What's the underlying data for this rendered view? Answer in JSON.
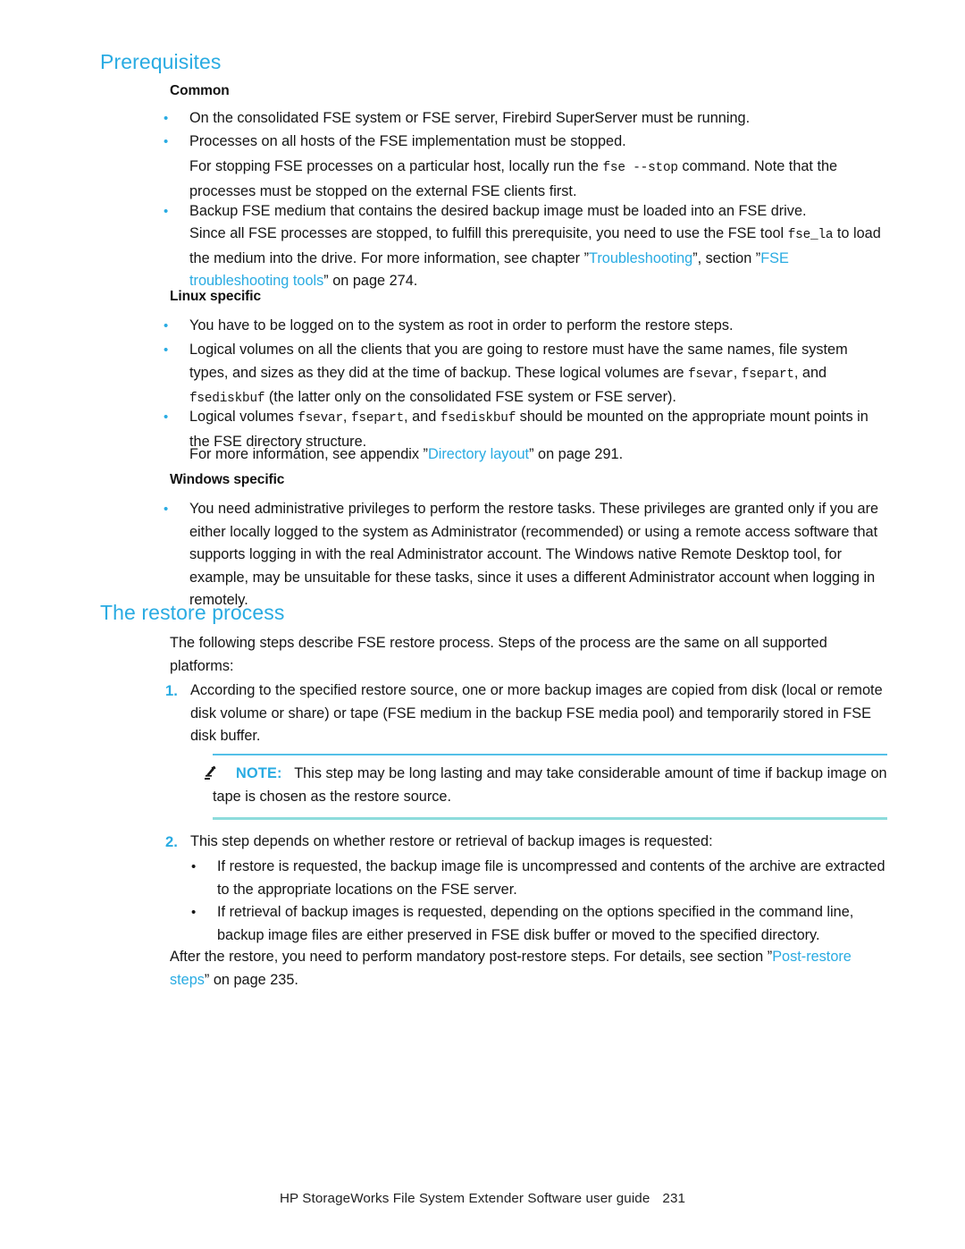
{
  "headings": {
    "prerequisites": "Prerequisites",
    "restore_process": "The restore process",
    "common": "Common",
    "linux_specific": "Linux specific",
    "windows_specific": "Windows specific"
  },
  "common": {
    "bullet_1": "On the consolidated FSE system or FSE server, Firebird SuperServer must be running.",
    "bullet_2": "Processes on all hosts of the FSE implementation must be stopped.",
    "para_2a": "For stopping FSE processes on a particular host, locally run the",
    "para_2a_cmd": "fse --stop",
    "para_2b": "command. Note that the processes must be stopped on the external FSE clients first.",
    "bullet_3": "Backup FSE medium that contains the desired backup image must be loaded into an FSE drive.",
    "para_3a": "Since all FSE processes are stopped, to fulfill this prerequisite, you need to use the FSE tool",
    "para_3a_cmd": "fse_la",
    "para_3b": "to load the medium into the drive. For more information, see chapter ”",
    "para_3_link1": "Troubleshooting",
    "para_3c": "”, section ”",
    "para_3_link2": "FSE troubleshooting tools",
    "para_3d": "” on page 274."
  },
  "linux": {
    "bullet_1": "You have to be logged on to the system as root in order to perform the restore steps.",
    "bullet_2a": "Logical volumes on all the clients that you are going to restore must have the same names, file system types, and sizes as they did at the time of backup. These logical volumes are",
    "bullet_2_cmd1": "fsevar",
    "bullet_2b": ",",
    "bullet_2_cmd2": "fsepart",
    "bullet_2c": ", and",
    "bullet_2_cmd3": "fsediskbuf",
    "bullet_2d": "(the latter only on the consolidated FSE system or FSE server).",
    "bullet_3a": "Logical volumes",
    "bullet_3_cmd1": "fsevar",
    "bullet_3b": ",",
    "bullet_3_cmd2": "fsepart",
    "bullet_3c": ", and",
    "bullet_3_cmd3": "fsediskbuf",
    "bullet_3d": "should be mounted on the appropriate mount points in the FSE directory structure.",
    "para_info": "For more information, see appendix ”",
    "para_info_link": "Directory layout",
    "para_info_end": "” on page 291."
  },
  "windows": {
    "bullet_1": "You need administrative privileges to perform the restore tasks. These privileges are granted only if you are either locally logged to the system as Administrator (recommended) or using a remote access software that supports logging in with the real Administrator account. The Windows native Remote Desktop tool, for example, may be unsuitable for these tasks, since it uses a different Administrator account when logging in remotely."
  },
  "restore": {
    "intro": "The following steps describe FSE restore process. Steps of the process are the same on all supported platforms:",
    "step_1_num": "1.",
    "step_1_text": "According to the specified restore source, one or more backup images are copied from disk (local or remote disk volume or share) or tape (FSE medium in the backup FSE media pool) and temporarily stored in FSE disk buffer.",
    "step_2_num": "2.",
    "step_2_text": "This step depends on whether restore or retrieval of backup images is requested:",
    "step_2_bullet_1": "If restore is requested, the backup image file is uncompressed and contents of the archive are extracted to the appropriate locations on the FSE server.",
    "step_2_bullet_2": "If retrieval of backup images is requested, depending on the options specified in the command line, backup image files are either preserved in FSE disk buffer or moved to the specified directory.",
    "closing_a": "After the restore, you need to perform mandatory post-restore steps. For details, see section ”",
    "closing_link": "Post-restore steps",
    "closing_b": "” on page 235."
  },
  "note": {
    "label": "NOTE:",
    "text": "This step may be long lasting and may take considerable amount of time if backup image on tape is chosen as the restore source.",
    "icon": "note-pencil-icon"
  },
  "footer": {
    "title": "HP StorageWorks File System Extender Software user guide",
    "page_number": "231"
  },
  "bullets": {
    "glyph": "•"
  },
  "colors": {
    "accent": "#29abe2",
    "note_rule_top": "#54c0e8",
    "note_rule_bottom": "#8ddcdc",
    "text": "#151515"
  }
}
